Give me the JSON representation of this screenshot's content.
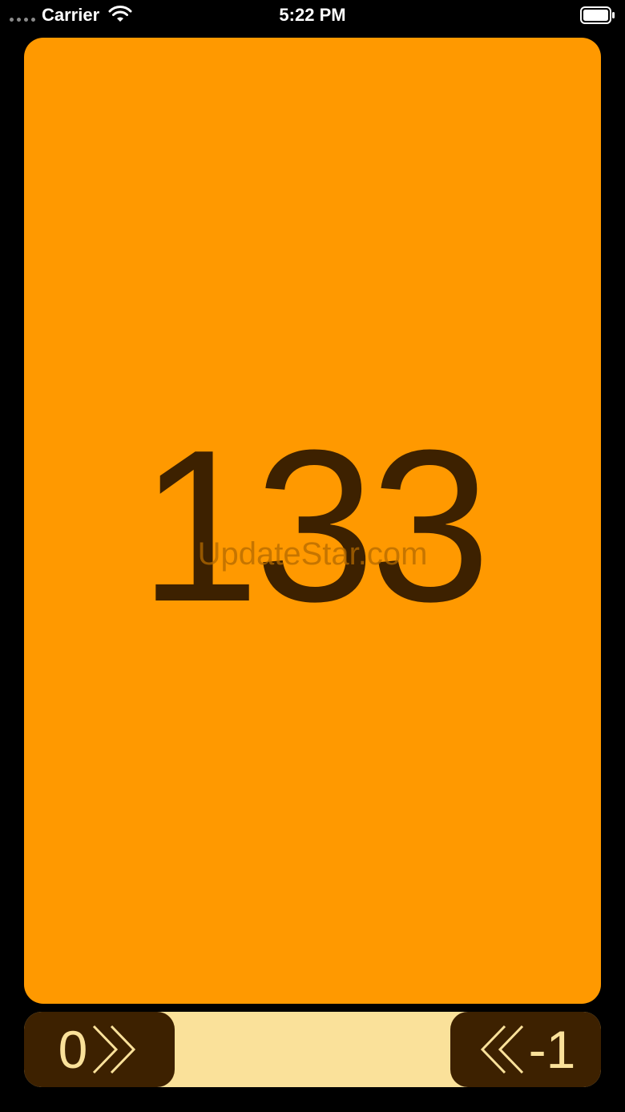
{
  "status_bar": {
    "carrier": "Carrier",
    "time": "5:22 PM"
  },
  "counter": {
    "value": "133",
    "watermark": "UpdateStar.com",
    "card_color": "#ff9900",
    "digit_color": "#3d2100"
  },
  "controls": {
    "reset_label": "0",
    "decrement_label": "-1",
    "bar_color": "#fae19a",
    "button_color": "#3d2100",
    "reset_icon": "chevron-double-right-icon",
    "decrement_icon": "chevron-double-left-icon"
  }
}
